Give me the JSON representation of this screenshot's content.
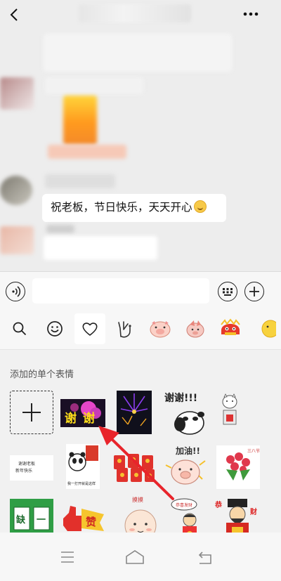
{
  "chat": {
    "message": "祝老板，节日快乐，天天开心",
    "emoji": "smile-emoji"
  },
  "input": {
    "value": "",
    "placeholder": ""
  },
  "tabs": [
    {
      "name": "search-icon"
    },
    {
      "name": "smiley-icon"
    },
    {
      "name": "heart-icon",
      "selected": true
    },
    {
      "name": "hand-gesture-sticker-pack"
    },
    {
      "name": "pig-sticker-pack"
    },
    {
      "name": "pig-sticker-pack-2"
    },
    {
      "name": "lion-dance-sticker-pack"
    },
    {
      "name": "emoji-sticker-pack"
    }
  ],
  "panel": {
    "section_title": "添加的单个表情",
    "stickers": [
      {
        "name": "add-sticker-button"
      },
      {
        "name": "xiexie-flowers-sticker",
        "text": "谢谢"
      },
      {
        "name": "fireworks-sticker"
      },
      {
        "name": "panda-xiexie-sticker",
        "text": "谢谢!!!"
      },
      {
        "name": "cat-gift-sticker"
      },
      {
        "name": "boss-text-sticker",
        "text": "谢谢老板\n新年快乐"
      },
      {
        "name": "panda-red-envelope-sticker",
        "text": "我一打开就是这样"
      },
      {
        "name": "red-envelopes-sticker"
      },
      {
        "name": "pig-jiayou-sticker",
        "text": "加油!!"
      },
      {
        "name": "flower-bouquet-sticker"
      },
      {
        "name": "mahjong-sticker",
        "text": "缺 一"
      },
      {
        "name": "thumbs-up-zan-sticker",
        "text": "赞"
      },
      {
        "name": "chubby-face-sticker"
      },
      {
        "name": "boy-gongxi-sticker"
      },
      {
        "name": "caishen-sticker"
      }
    ]
  },
  "annotation": {
    "arrow_color": "#e8242b"
  }
}
